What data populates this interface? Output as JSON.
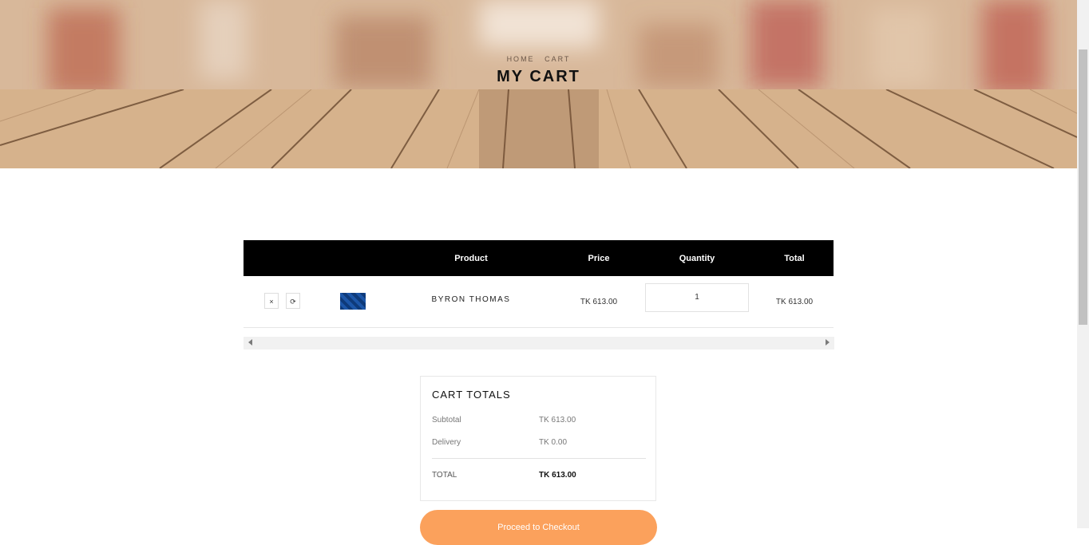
{
  "hero": {
    "breadcrumb": [
      "HOME",
      "CART"
    ],
    "title": "MY CART"
  },
  "table": {
    "columns": [
      "",
      "",
      "Product",
      "Price",
      "Quantity",
      "Total"
    ],
    "rows": [
      {
        "remove_icon": "×",
        "refresh_icon": "⟳",
        "product": "BYRON THOMAS",
        "price": "TK 613.00",
        "quantity": "1",
        "total": "TK 613.00"
      }
    ]
  },
  "totals": {
    "title": "CART TOTALS",
    "subtotal_label": "Subtotal",
    "subtotal_value": "TK 613.00",
    "delivery_label": "Delivery",
    "delivery_value": "TK 0.00",
    "total_label": "TOTAL",
    "total_value": "TK 613.00"
  },
  "checkout": {
    "label": "Proceed to Checkout"
  },
  "colors": {
    "accent": "#fba15c",
    "header_bg": "#000000"
  },
  "icons": [
    "close-icon",
    "refresh-icon",
    "scroll-left-arrow-icon",
    "scroll-right-arrow-icon"
  ]
}
